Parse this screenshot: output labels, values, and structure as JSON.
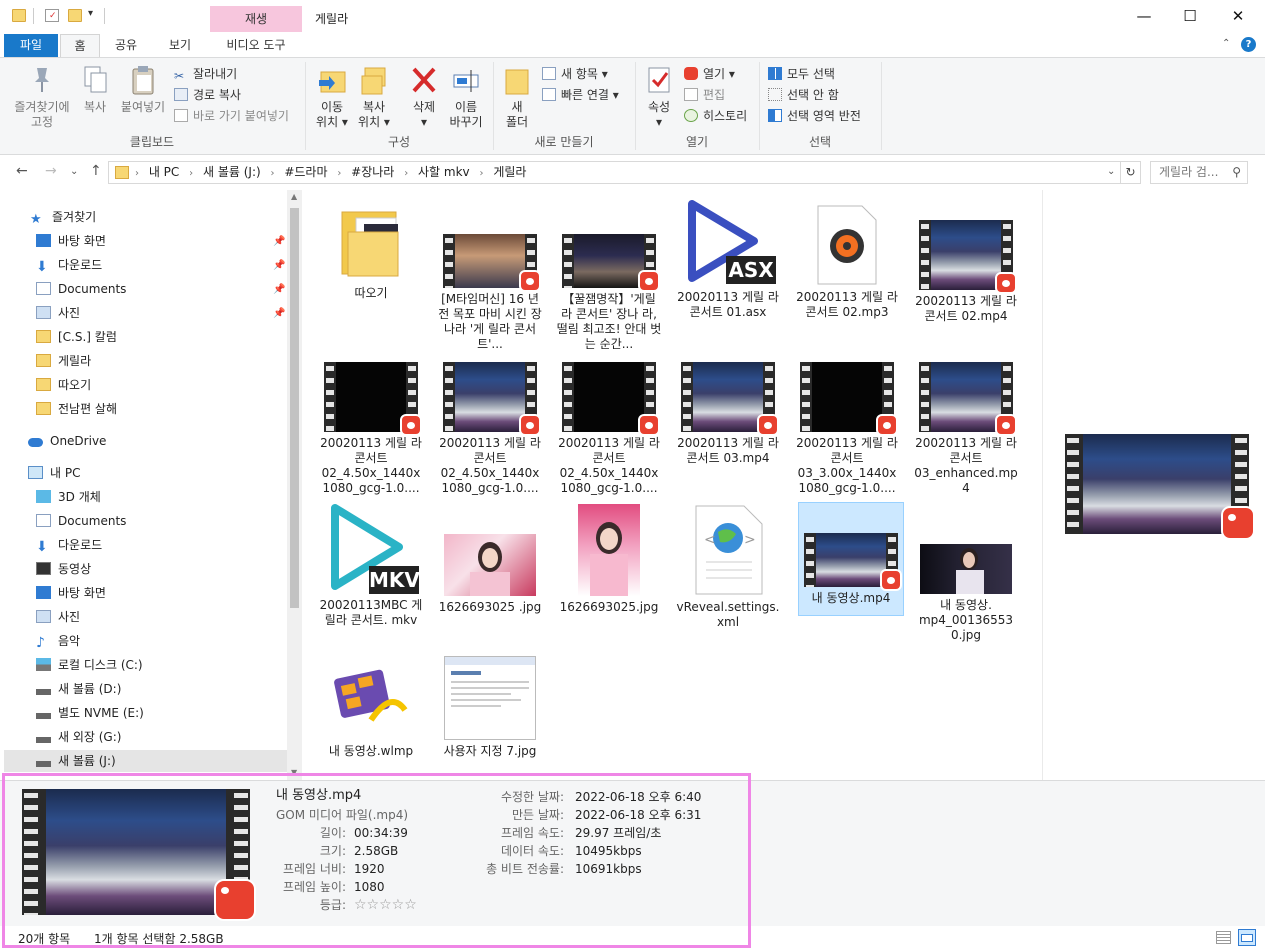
{
  "window": {
    "title": "게릴라",
    "context_tab": "재생",
    "controls": {
      "minimize": "—",
      "maximize": "☐",
      "close": "✕"
    }
  },
  "tabs": {
    "file": "파일",
    "home": "홈",
    "share": "공유",
    "view": "보기",
    "video_tools": "비디오 도구"
  },
  "ribbon": {
    "clipboard": {
      "label": "클립보드",
      "pin": "즐겨찾기에\n고정",
      "copy": "복사",
      "paste": "붙여넣기",
      "cut": "잘라내기",
      "copy_path": "경로 복사",
      "paste_shortcut": "바로 가기 붙여넣기"
    },
    "organize": {
      "label": "구성",
      "move_to": "이동\n위치 ▾",
      "copy_to": "복사\n위치 ▾",
      "delete": "삭제\n▾",
      "rename": "이름\n바꾸기"
    },
    "new": {
      "label": "새로 만들기",
      "new_folder": "새\n폴더",
      "new_item": "새 항목 ▾",
      "easy_access": "빠른 연결 ▾"
    },
    "open": {
      "label": "열기",
      "properties": "속성\n▾",
      "open": "열기 ▾",
      "edit": "편집",
      "history": "히스토리"
    },
    "select": {
      "label": "선택",
      "select_all": "모두 선택",
      "select_none": "선택 안 함",
      "invert": "선택 영역 반전"
    }
  },
  "address": {
    "crumbs": [
      "내 PC",
      "새 볼륨 (J:)",
      "#드라마",
      "#장나라",
      "사할 mkv",
      "게릴라"
    ],
    "search_placeholder": "게릴라 검..."
  },
  "nav": {
    "quick_access": "즐겨찾기",
    "quick_items": [
      "바탕 화면",
      "다운로드",
      "Documents",
      "사진",
      "[C.S.] 칼럼",
      "게릴라",
      "따오기",
      "전남편 살해"
    ],
    "onedrive": "OneDrive",
    "this_pc": "내 PC",
    "pc_items": [
      "3D 개체",
      "Documents",
      "다운로드",
      "동영상",
      "바탕 화면",
      "사진",
      "음악",
      "로컬 디스크 (C:)",
      "새 볼륨 (D:)",
      "별도 NVME (E:)",
      "새 외장 (G:)",
      "새 볼륨 (J:)"
    ]
  },
  "files": [
    {
      "name": "따오기",
      "kind": "folder"
    },
    {
      "name": "[M타임머신] 16 년 전 목포 마비 시킨 장나라 '게 릴라 콘서트'...",
      "kind": "video",
      "look": "crowd"
    },
    {
      "name": "【꿀잼명작】'게릴 라 콘서트' 장나 라, 떨림 최고조! 안대 벗는 순간...",
      "kind": "video",
      "look": "stage"
    },
    {
      "name": "20020113 게릴 라콘서트 01.asx",
      "kind": "asx",
      "badge": "ASX"
    },
    {
      "name": "20020113 게릴 라콘서트 02.mp3",
      "kind": "mp3"
    },
    {
      "name": "20020113 게릴 라콘서트 02.mp4",
      "kind": "video",
      "look": "concert"
    },
    {
      "name": "20020113 게릴 라콘서트 02_4.50x_1440x 1080_gcg-1.0....",
      "kind": "video",
      "look": "black"
    },
    {
      "name": "20020113 게릴 라콘서트 02_4.50x_1440x 1080_gcg-1.0....",
      "kind": "video",
      "look": "concert"
    },
    {
      "name": "20020113 게릴 라콘서트 02_4.50x_1440x 1080_gcg-1.0....",
      "kind": "video",
      "look": "black"
    },
    {
      "name": "20020113 게릴 라콘서트 03.mp4",
      "kind": "video",
      "look": "concert"
    },
    {
      "name": "20020113 게릴 라콘서트 03_3.00x_1440x 1080_gcg-1.0....",
      "kind": "video",
      "look": "black"
    },
    {
      "name": "20020113 게릴 라콘서트 03_enhanced.mp 4",
      "kind": "video",
      "look": "concert"
    },
    {
      "name": "20020113MBC 게릴라 콘서트. mkv",
      "kind": "mkv",
      "badge": "MKV"
    },
    {
      "name": "1626693025 .jpg",
      "kind": "photo-pink"
    },
    {
      "name": "1626693025.jpg",
      "kind": "photo-pink2"
    },
    {
      "name": "vReveal.settings. xml",
      "kind": "xml"
    },
    {
      "name": "내 동영상.mp4",
      "kind": "video",
      "look": "concert",
      "selected": true
    },
    {
      "name": "내 동영상. mp4_00136553 0.jpg",
      "kind": "photo-dark"
    },
    {
      "name": "내 동영상.wlmp",
      "kind": "wlmp"
    },
    {
      "name": "사용자 지정 7.jpg",
      "kind": "screenshot"
    }
  ],
  "details": {
    "name": "내 동영상.mp4",
    "type": "GOM 미디어 파일(.mp4)",
    "left": [
      {
        "k": "길이:",
        "v": "00:34:39"
      },
      {
        "k": "크기:",
        "v": "2.58GB"
      },
      {
        "k": "프레임 너비:",
        "v": "1920"
      },
      {
        "k": "프레임 높이:",
        "v": "1080"
      },
      {
        "k": "등급:",
        "v": "☆☆☆☆☆"
      }
    ],
    "right": [
      {
        "k": "수정한 날짜:",
        "v": "2022-06-18 오후 6:40"
      },
      {
        "k": "만든 날짜:",
        "v": "2022-06-18 오후 6:31"
      },
      {
        "k": "프레임 속도:",
        "v": "29.97 프레임/초"
      },
      {
        "k": "데이터 속도:",
        "v": "10495kbps"
      },
      {
        "k": "총 비트 전송률:",
        "v": "10691kbps"
      }
    ]
  },
  "status": {
    "count": "20개 항목",
    "selection": "1개 항목 선택함 2.58GB"
  },
  "colors": {
    "accent": "#1979ca",
    "context_tab": "#f7c6dd",
    "highlight": "#ef86e6",
    "selection": "#cce8ff",
    "gom": "#e8402f"
  }
}
